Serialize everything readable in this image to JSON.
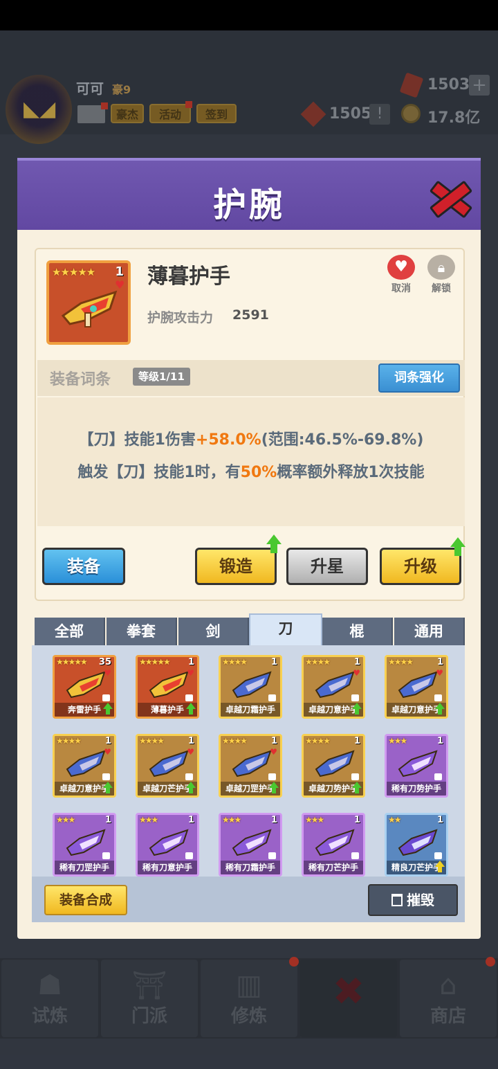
{
  "hud": {
    "player_name": "可可",
    "vip": "豪9",
    "buttons": [
      "豪杰",
      "活动",
      "签到"
    ],
    "gems": "1503",
    "tokens": "1505",
    "coins": "17.8亿",
    "plus": "+",
    "excl": "!"
  },
  "bottom_nav": [
    {
      "label": "试炼",
      "icon": "ninja-icon"
    },
    {
      "label": "门派",
      "icon": "temple-icon"
    },
    {
      "label": "修炼",
      "icon": "scroll-book-icon"
    },
    {
      "label": "",
      "icon": "close-icon"
    },
    {
      "label": "商店",
      "icon": "shop-icon"
    }
  ],
  "modal": {
    "title": "护腕",
    "item": {
      "name": "薄暮护手",
      "stars": "★★★★★",
      "count": "1",
      "attr_label": "护腕攻击力",
      "attr_value": "2591",
      "cancel_label": "取消",
      "unlock_label": "解锁"
    },
    "affix": {
      "title": "装备词条",
      "level": "等级1/11",
      "enhance_label": "词条强化",
      "line1_pre": "【刀】技能1伤害",
      "line1_hl": "+58.0%",
      "line1_post": "(范围:46.5%-69.8%)",
      "line2_pre": "触发【刀】技能1时，有",
      "line2_hl": "50%",
      "line2_post": "概率额外释放1次技能"
    },
    "actions": {
      "equip": "装备",
      "forge": "锻造",
      "star_up": "升星",
      "upgrade": "升级"
    },
    "tabs": [
      "全部",
      "拳套",
      "剑",
      "刀",
      "棍",
      "通用"
    ],
    "active_tab": 3,
    "items": [
      {
        "name": "奔雷护手",
        "stars": "★★★★★",
        "count": "35",
        "rarity": "orange",
        "heart": true,
        "up": "green"
      },
      {
        "name": "薄暮护手",
        "stars": "★★★★★",
        "count": "1",
        "rarity": "orange",
        "heart": true,
        "up": "green"
      },
      {
        "name": "卓越刀霜护手",
        "stars": "★★★★",
        "count": "1",
        "rarity": "gold",
        "heart": false,
        "up": ""
      },
      {
        "name": "卓越刀意护手",
        "stars": "★★★★",
        "count": "1",
        "rarity": "gold",
        "heart": true,
        "up": "green"
      },
      {
        "name": "卓越刀意护手",
        "stars": "★★★★",
        "count": "1",
        "rarity": "gold",
        "heart": true,
        "up": "green"
      },
      {
        "name": "卓越刀意护手",
        "stars": "★★★★",
        "count": "1",
        "rarity": "gold",
        "heart": true,
        "up": "green"
      },
      {
        "name": "卓越刀芒护手",
        "stars": "★★★★",
        "count": "1",
        "rarity": "gold",
        "heart": true,
        "up": "green"
      },
      {
        "name": "卓越刀罡护手",
        "stars": "★★★★",
        "count": "1",
        "rarity": "gold",
        "heart": true,
        "up": "green"
      },
      {
        "name": "卓越刀势护手",
        "stars": "★★★★",
        "count": "1",
        "rarity": "gold",
        "heart": false,
        "up": "green"
      },
      {
        "name": "稀有刀势护手",
        "stars": "★★★",
        "count": "1",
        "rarity": "purple",
        "heart": false,
        "up": ""
      },
      {
        "name": "稀有刀罡护手",
        "stars": "★★★",
        "count": "1",
        "rarity": "purple",
        "heart": false,
        "up": ""
      },
      {
        "name": "稀有刀意护手",
        "stars": "★★★",
        "count": "1",
        "rarity": "purple",
        "heart": false,
        "up": ""
      },
      {
        "name": "稀有刀霜护手",
        "stars": "★★★",
        "count": "1",
        "rarity": "purple",
        "heart": false,
        "up": ""
      },
      {
        "name": "稀有刀芒护手",
        "stars": "★★★",
        "count": "1",
        "rarity": "purple",
        "heart": false,
        "up": ""
      },
      {
        "name": "精良刀芒护手",
        "stars": "★★",
        "count": "1",
        "rarity": "blue",
        "heart": false,
        "up": "yellow"
      }
    ],
    "synth_label": "装备合成",
    "destroy_label": "摧毁"
  },
  "colors": {
    "header_purple": "#6248a2",
    "highlight_orange": "#f07810",
    "equip_blue": "#2a8fd8",
    "forge_yellow": "#f0b820"
  }
}
